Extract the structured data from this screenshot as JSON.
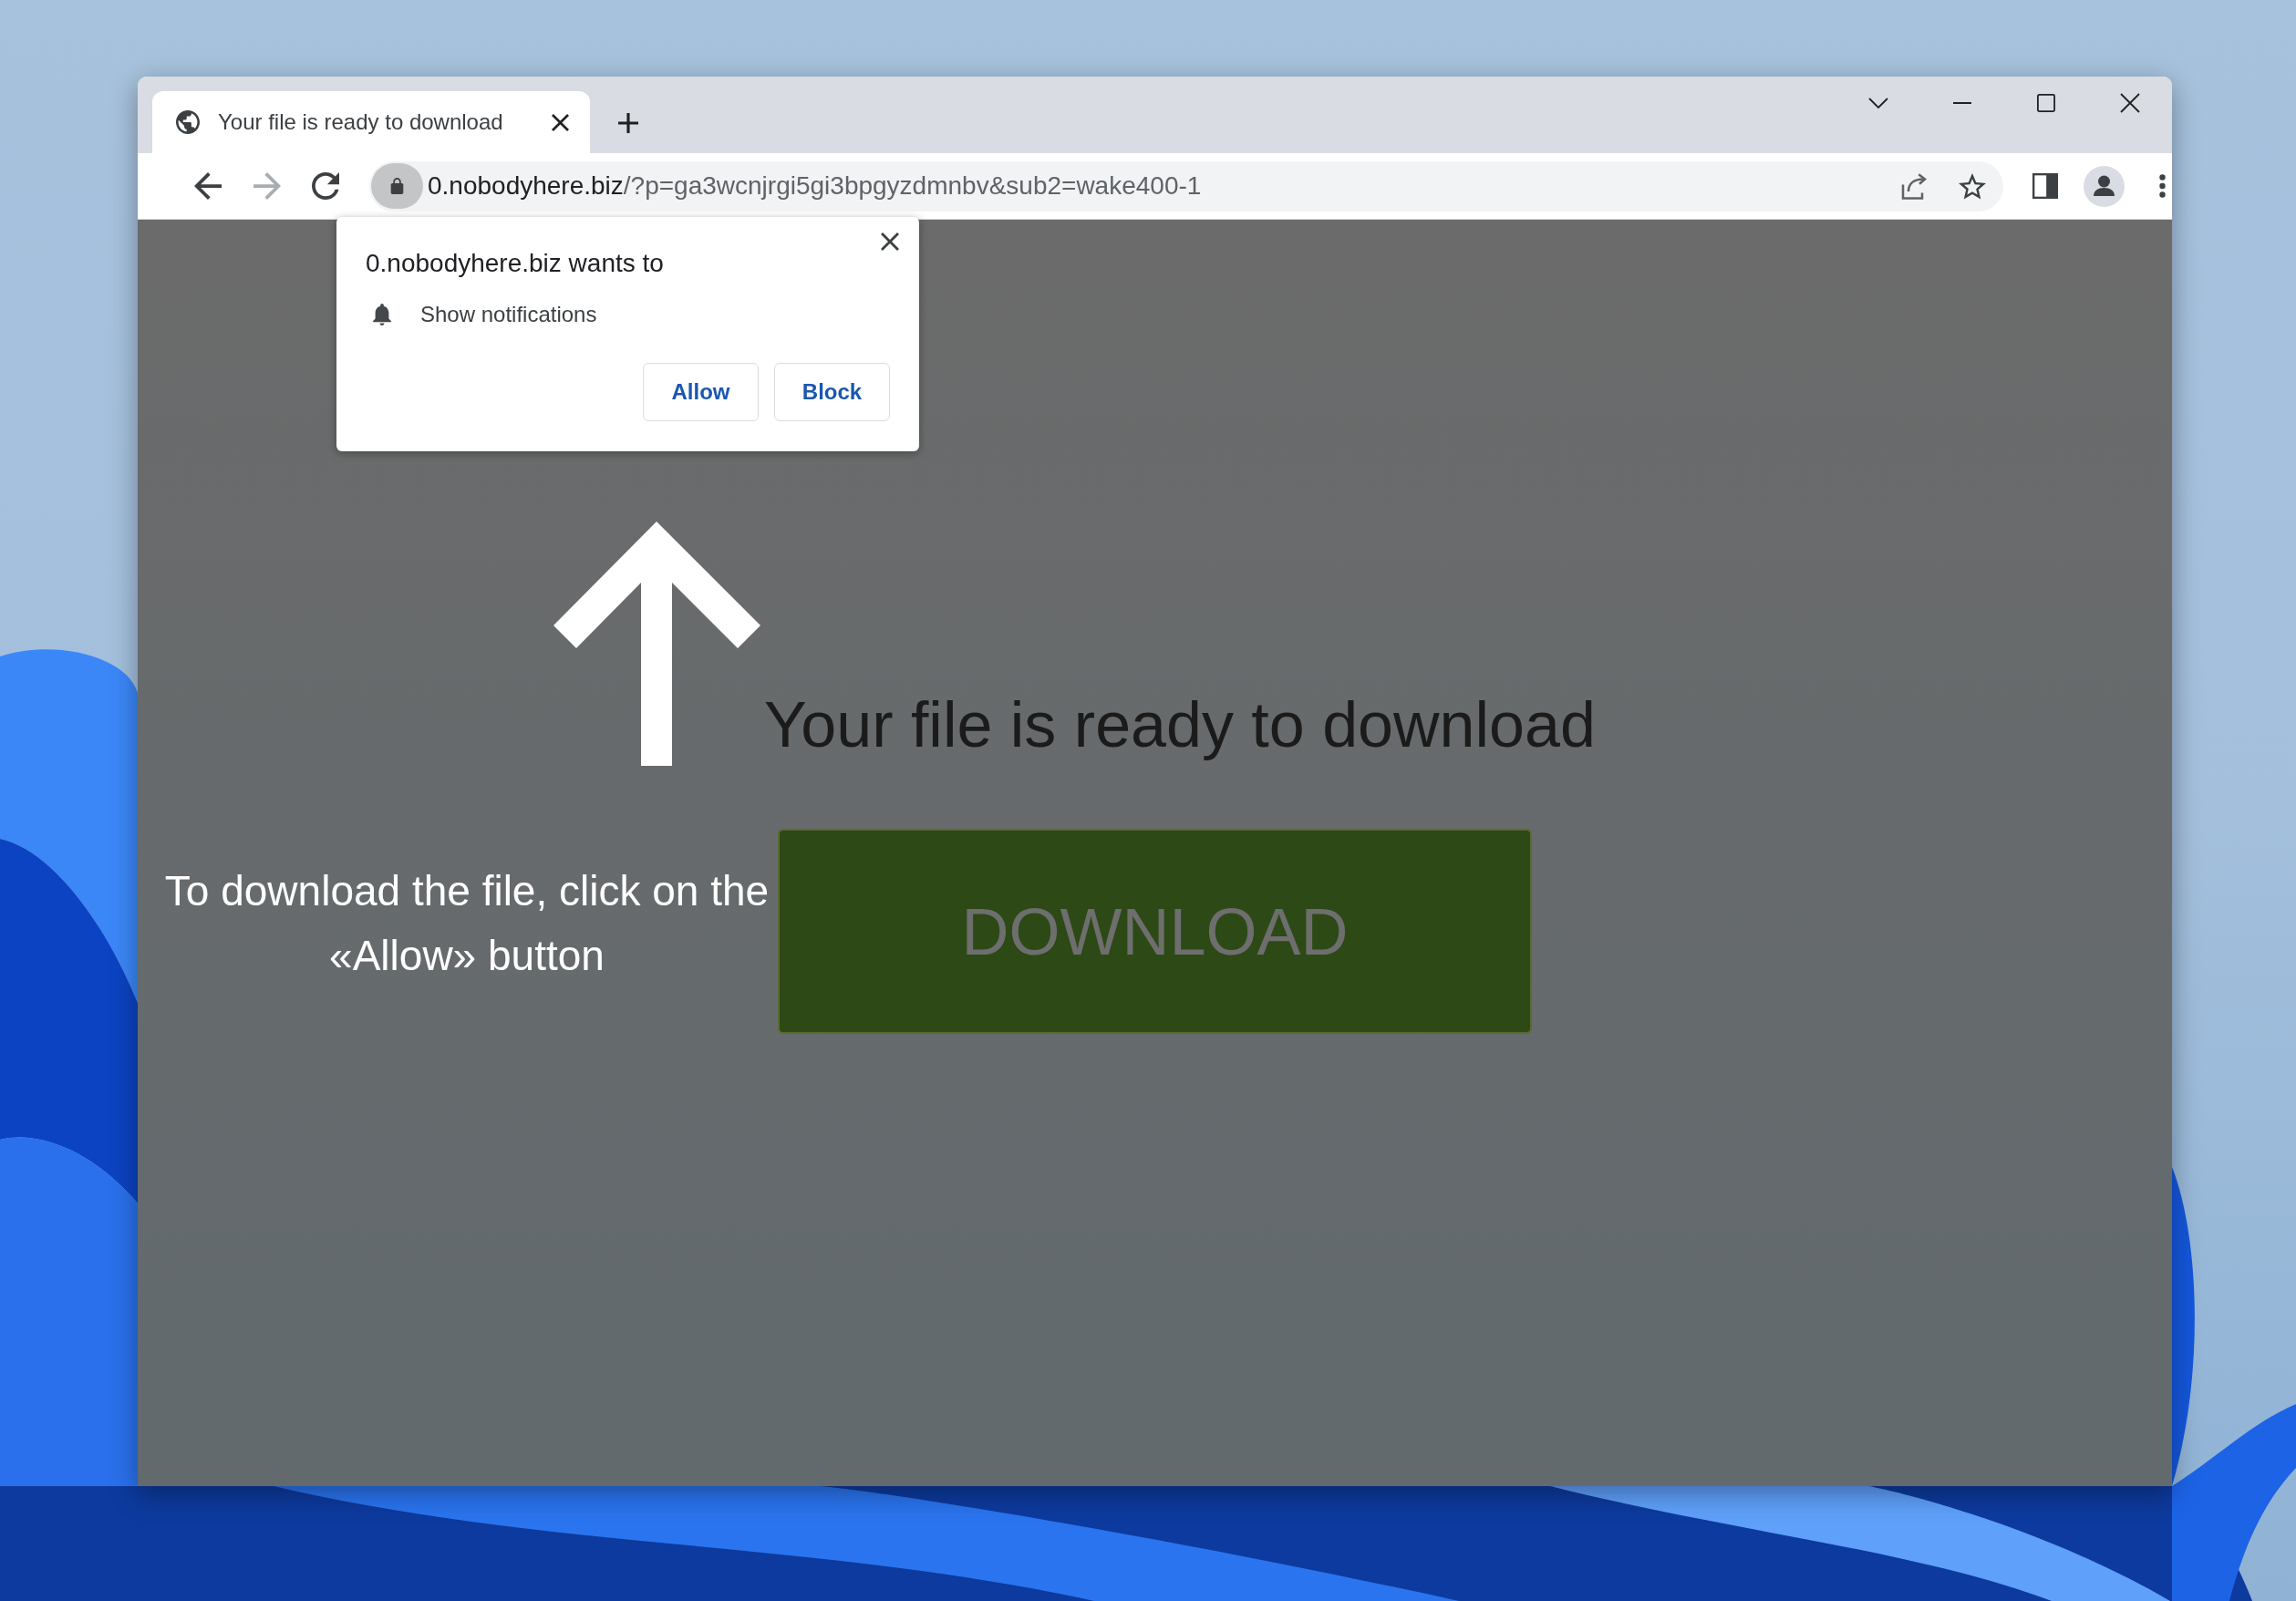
{
  "browser": {
    "tabs": [
      {
        "title": "Your file is ready to download",
        "selected": true
      }
    ]
  },
  "toolbar": {
    "nav": [
      {
        "kind": "back",
        "disabled": false
      },
      {
        "kind": "forward",
        "disabled": true
      },
      {
        "kind": "reload",
        "disabled": false
      }
    ],
    "address": {
      "host": "0.nobodyhere.biz",
      "path": "/?p=ga3wcnjrgi5gi3bpgyzdmnbv&sub2=wake400-1"
    }
  },
  "permission_prompt": {
    "title": "0.nobodyhere.biz wants to",
    "permission": "Show notifications",
    "buttons": [
      "Allow",
      "Block"
    ]
  },
  "page": {
    "heading": "Your file is ready to download",
    "download_button": "DOWNLOAD",
    "instruction": "To download the file, click on the «Allow» button"
  }
}
